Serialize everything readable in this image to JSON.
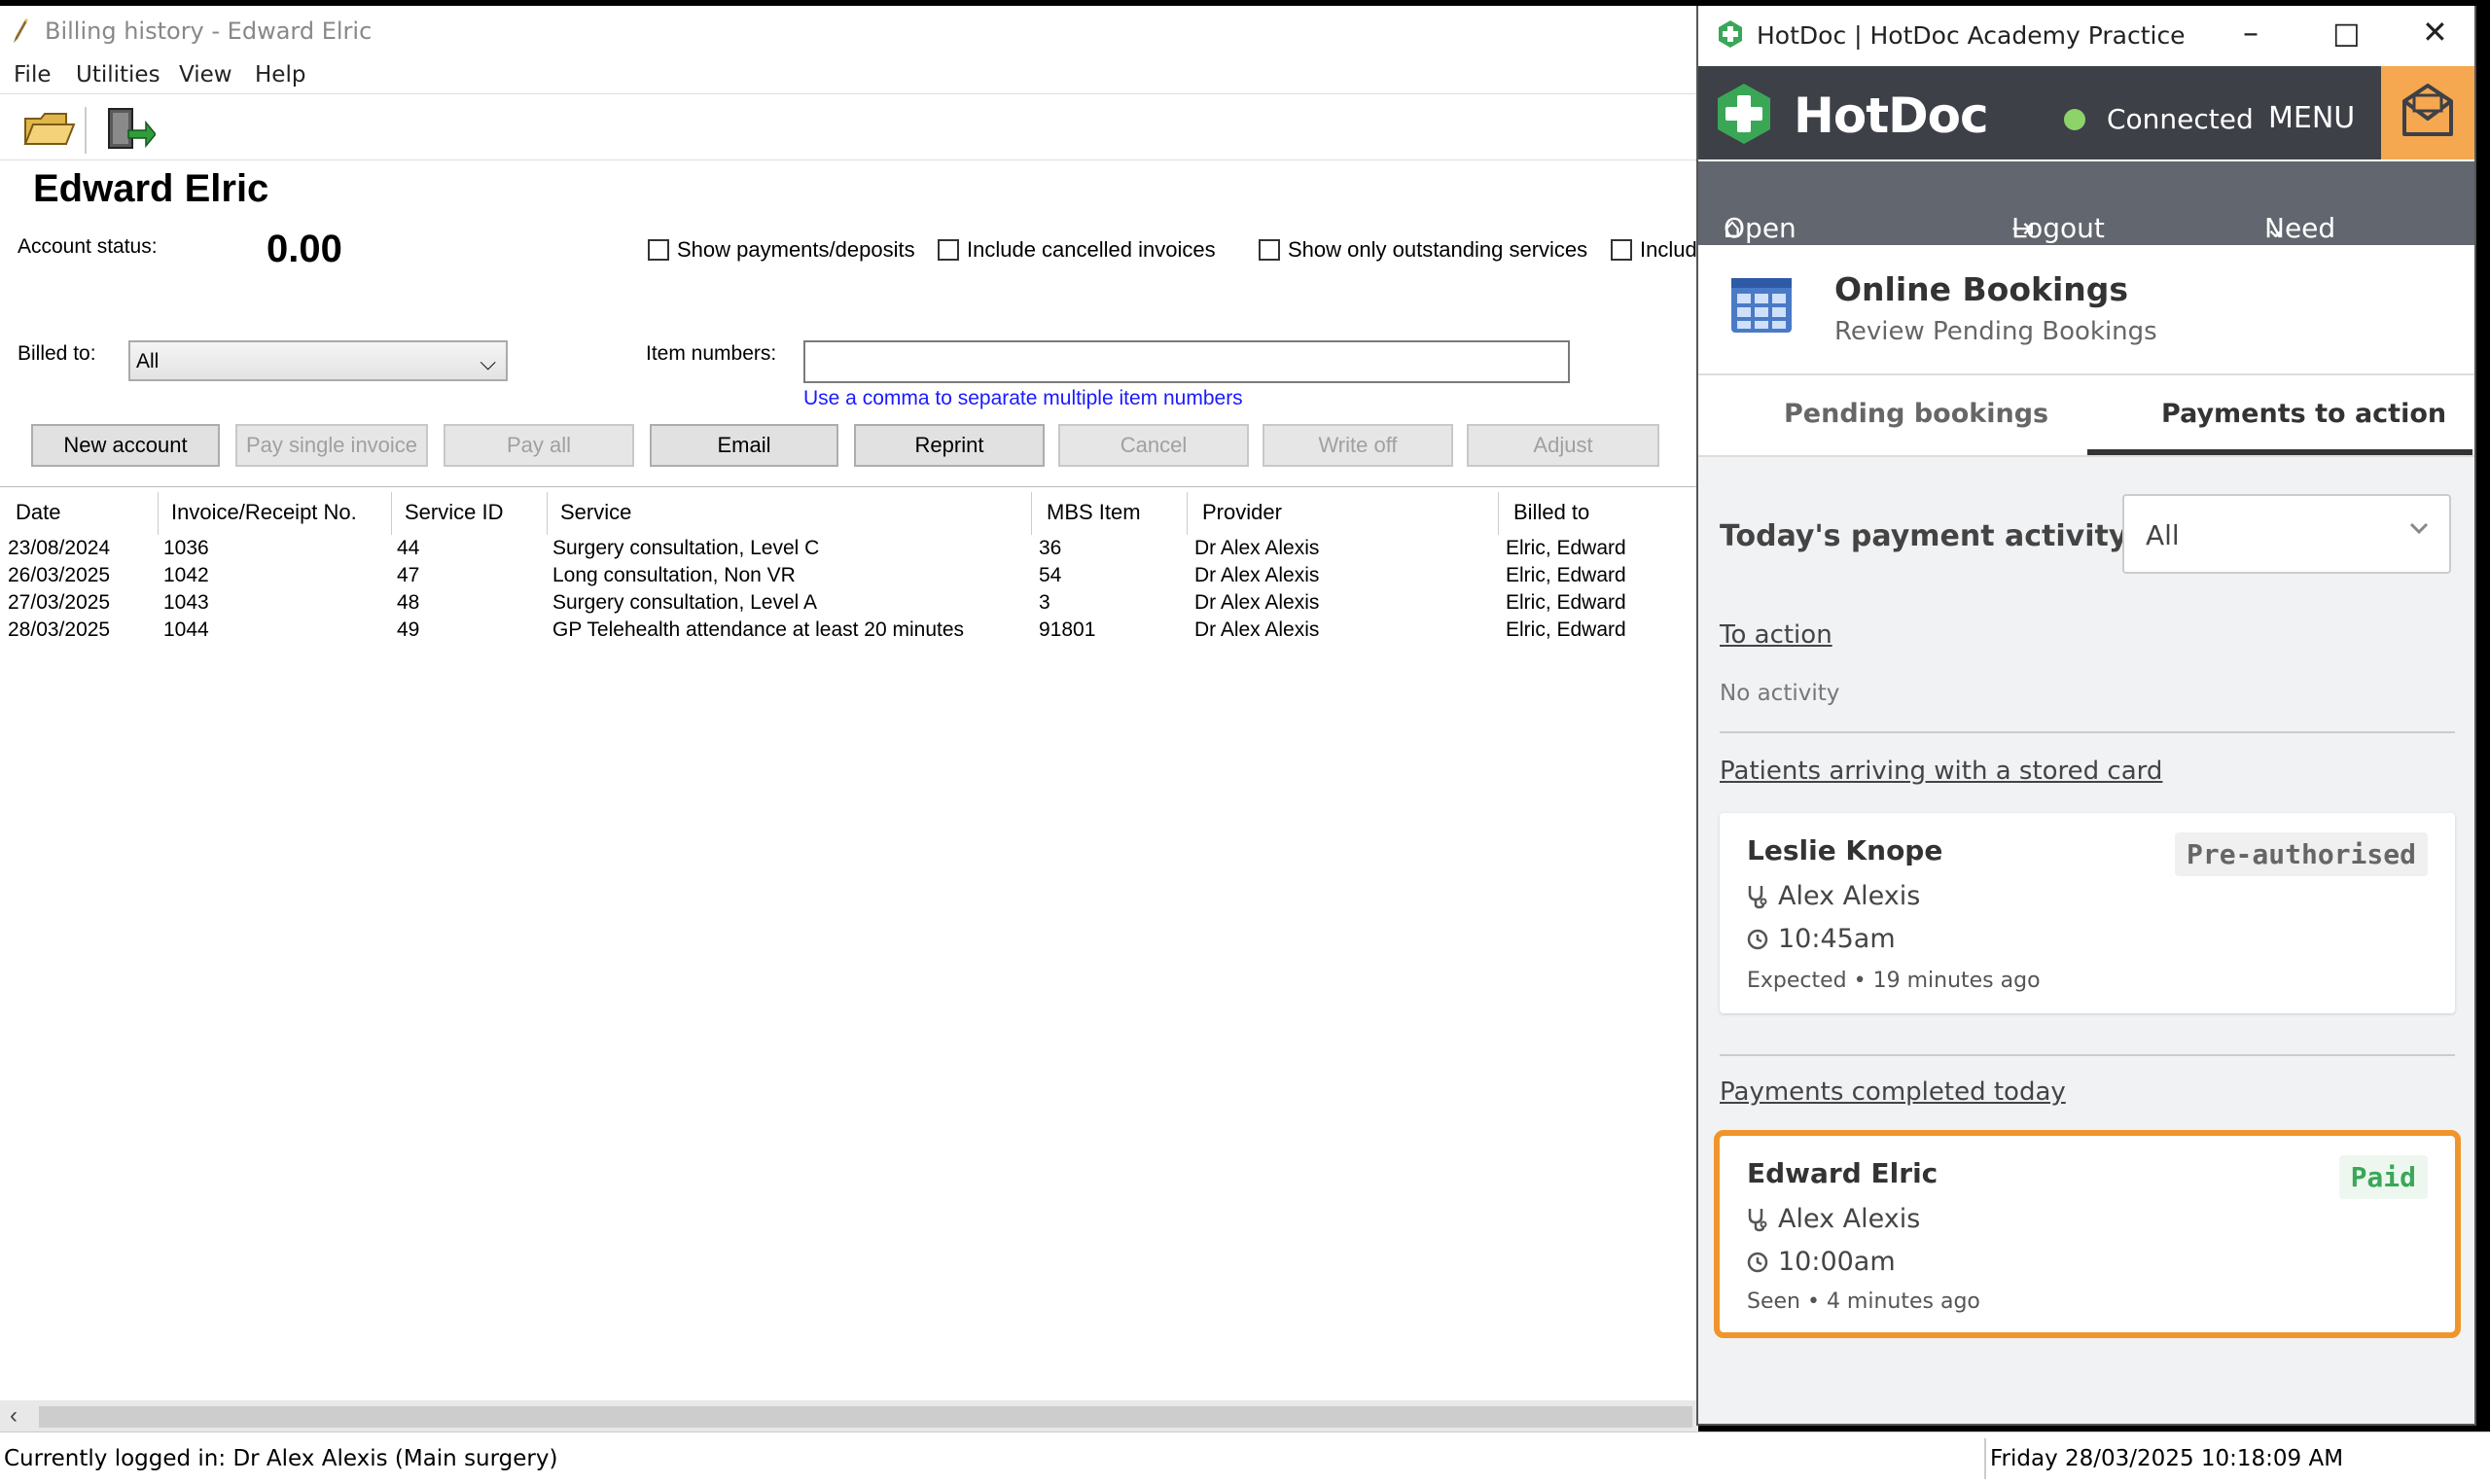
{
  "billing": {
    "window_title": "Billing history - Edward Elric",
    "menu": [
      "File",
      "Utilities",
      "View",
      "Help"
    ],
    "patient_name": "Edward Elric",
    "account_status_label": "Account status:",
    "account_status_value": "0.00",
    "checkboxes": [
      "Show payments/deposits",
      "Include cancelled invoices",
      "Show only outstanding services",
      "Includ"
    ],
    "billed_to_label": "Billed to:",
    "billed_to_value": "All",
    "item_numbers_label": "Item numbers:",
    "item_numbers_value": "",
    "item_numbers_hint": "Use a comma to separate multiple item numbers",
    "buttons": [
      "New account",
      "Pay single invoice",
      "Pay all",
      "Email",
      "Reprint",
      "Cancel",
      "Write off",
      "Adjust"
    ],
    "columns": [
      "Date",
      "Invoice/Receipt No.",
      "Service ID",
      "Service",
      "MBS Item",
      "Provider",
      "Billed to"
    ],
    "rows": [
      [
        "23/08/2024",
        "1036",
        "44",
        "Surgery consultation, Level C",
        "36",
        "Dr Alex Alexis",
        "Elric, Edward"
      ],
      [
        "26/03/2025",
        "1042",
        "47",
        "Long consultation, Non VR",
        "54",
        "Dr Alex Alexis",
        "Elric, Edward"
      ],
      [
        "27/03/2025",
        "1043",
        "48",
        "Surgery consultation, Level A",
        "3",
        "Dr Alex Alexis",
        "Elric, Edward"
      ],
      [
        "28/03/2025",
        "1044",
        "49",
        "GP Telehealth attendance at least 20 minutes",
        "91801",
        "Dr Alex Alexis",
        "Elric, Edward"
      ]
    ],
    "status_left": "Currently logged in:  Dr Alex Alexis (Main surgery)",
    "status_right": "Friday 28/03/2025 10:18:09 AM"
  },
  "hotdoc": {
    "window_title": "HotDoc | HotDoc Academy Practice",
    "brand": "HotDoc",
    "connection": "Connected",
    "menu": "MENU",
    "nav_dashboard": "Open Dashboard",
    "nav_logout": "Logout",
    "nav_help": "Need help?",
    "ob_title": "Online Bookings",
    "ob_subtitle": "Review Pending Bookings",
    "tab_pending": "Pending bookings",
    "tab_payments": "Payments to action",
    "activity_label": "Today's payment activity",
    "activity_filter": "All",
    "to_action_label": "To action",
    "no_activity": "No activity",
    "stored_card_label": "Patients arriving with a stored card",
    "stored_card": {
      "name": "Leslie Knope",
      "badge": "Pre-authorised",
      "provider": "Alex Alexis",
      "time": "10:45am",
      "meta": "Expected • 19 minutes ago"
    },
    "completed_label": "Payments completed today",
    "completed": {
      "name": "Edward Elric",
      "badge": "Paid",
      "provider": "Alex Alexis",
      "time": "10:00am",
      "meta": "Seen • 4 minutes ago"
    },
    "colors": {
      "header": "#3d4047",
      "nav": "#62666e",
      "accent_orange": "#f0952b",
      "brand_green": "#3aa757",
      "paid_green": "#3aa757"
    }
  }
}
